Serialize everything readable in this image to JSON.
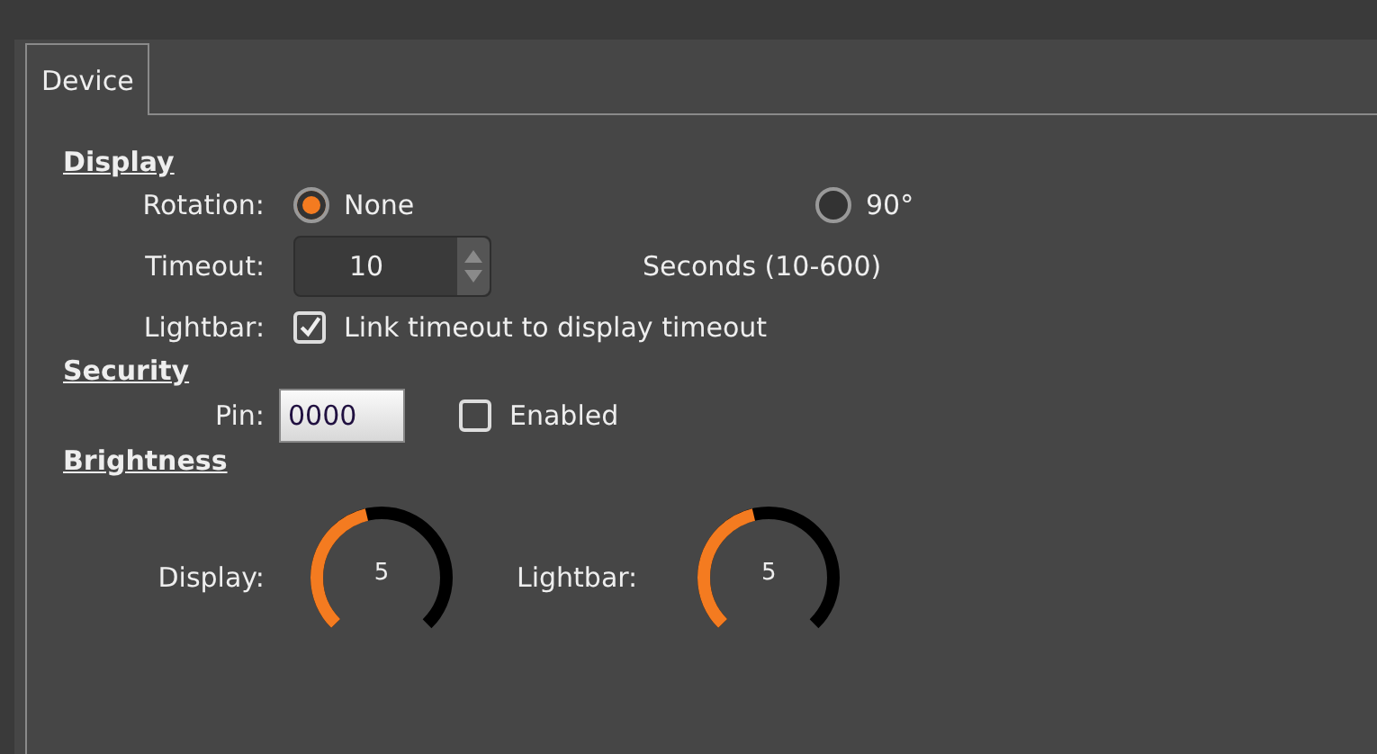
{
  "tab": {
    "label": "Device"
  },
  "display": {
    "heading": "Display",
    "rotation": {
      "label": "Rotation:",
      "options": [
        {
          "label": "None",
          "selected": true
        },
        {
          "label": "90°",
          "selected": false
        }
      ]
    },
    "timeout": {
      "label": "Timeout:",
      "value": "10",
      "hint": "Seconds (10-600)"
    },
    "lightbar": {
      "label": "Lightbar:",
      "checkbox": {
        "label": "Link timeout to display timeout",
        "checked": true
      }
    }
  },
  "security": {
    "heading": "Security",
    "pin": {
      "label": "Pin:",
      "value": "0000"
    },
    "enabled": {
      "label": "Enabled",
      "checked": false
    }
  },
  "brightness": {
    "heading": "Brightness",
    "knobs": [
      {
        "label": "Display:",
        "value": "5",
        "level": 0.45
      },
      {
        "label": "Lightbar:",
        "value": "5",
        "level": 0.45
      }
    ]
  }
}
